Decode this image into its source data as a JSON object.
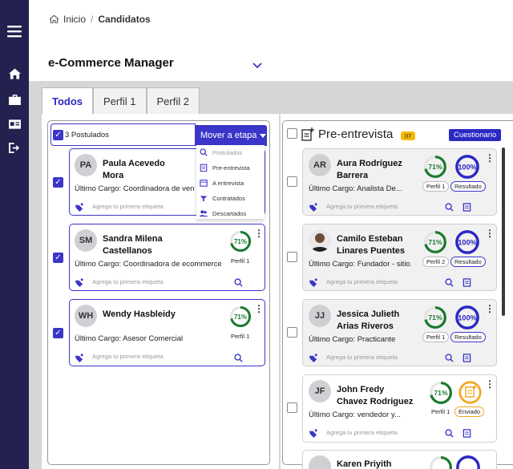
{
  "breadcrumb": {
    "home": "Inicio",
    "sep": "/",
    "current": "Candidatos"
  },
  "page": {
    "title": "e-Commerce Manager"
  },
  "tabs": [
    "Todos",
    "Perfil 1",
    "Perfil 2"
  ],
  "left": {
    "count_label": "3 Postulados",
    "move_button": "Mover a etapa",
    "menu": [
      "Postulados",
      "Pre-entrevista",
      "A entrevista",
      "Contratados",
      "Descartados"
    ],
    "candidates": [
      {
        "initials": "PA",
        "name1": "Paula Acevedo",
        "name2": "Mora",
        "cargo": "Último Cargo: Coordinadora de ventas",
        "tag": "Agrega tu primera etiqueta"
      },
      {
        "initials": "SM",
        "name1": "Sandra Milena",
        "name2": "Castellanos",
        "cargo": "Último Cargo: Coordinadora de ecommerce ...",
        "tag": "Agrega tu primera etiqueta",
        "pct": "71%",
        "perfil": "Perfil 1"
      },
      {
        "initials": "WH",
        "name1": "Wendy Hasbleidy",
        "name2": "",
        "cargo": "Último Cargo: Asesor Comercial",
        "tag": "Agrega tu primera etiqueta",
        "pct": "71%",
        "perfil": "Perfil 1"
      }
    ]
  },
  "right": {
    "title": "Pre-entrevista",
    "badge": "07",
    "quiz_button": "Cuestionario",
    "candidates": [
      {
        "initials": "AR",
        "name1": "Aura Rodríguez",
        "name2": "Barrera",
        "cargo": "Último Cargo: Analista De...",
        "tag": "Agrega tu primera etiqueta",
        "pct": "71%",
        "perfil": "Perfil 1",
        "score": "100%",
        "status": "Resultado"
      },
      {
        "initials": "",
        "name1": "Camilo Esteban",
        "name2": "Linares Puentes",
        "cargo": "Último Cargo: Fundador - sitio...",
        "tag": "Agrega tu primera etiqueta",
        "pct": "71%",
        "perfil": "Perfil 2",
        "score": "100%",
        "status": "Resultado"
      },
      {
        "initials": "JJ",
        "name1": "Jessica Julieth",
        "name2": "Arias Riveros",
        "cargo": "Último Cargo: Practicante",
        "tag": "Agrega tu primera etiqueta",
        "pct": "71%",
        "perfil": "Perfil 1",
        "score": "100%",
        "status": "Resultado"
      },
      {
        "initials": "JF",
        "name1": "John Fredy",
        "name2": "Chavez Rodriguez",
        "cargo": "Último Cargo: vendedor y...",
        "tag": "Agrega tu primera etiqueta",
        "pct": "71%",
        "perfil": "Perfil 1",
        "score": "",
        "status": "Enviado"
      },
      {
        "initials": "",
        "name1": "Karen Priyith",
        "name2": "",
        "cargo": "",
        "tag": "",
        "pct": "",
        "perfil": "",
        "score": "",
        "status": ""
      }
    ]
  },
  "colors": {
    "accent": "#3b36c9",
    "sidebar": "#23214f",
    "green": "#1a7a2e",
    "orange": "#f5a623",
    "badge": "#f5b800"
  }
}
